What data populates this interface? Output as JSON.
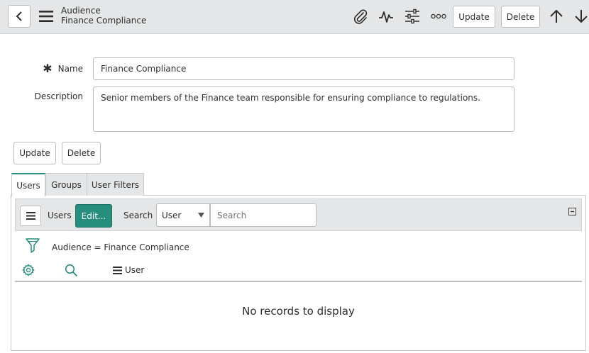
{
  "header": {
    "table_name": "Audience",
    "record_name": "Finance Compliance",
    "update_label": "Update",
    "delete_label": "Delete",
    "icons": [
      "back-icon",
      "menu-icon",
      "attachment-icon",
      "activity-icon",
      "settings-sliders-icon",
      "more-icon",
      "arrow-up-icon",
      "arrow-down-icon"
    ]
  },
  "form": {
    "name_label": "Name",
    "name_required_mark": "✱",
    "name_value": "Finance Compliance",
    "description_label": "Description",
    "description_value": "Senior members of the Finance team responsible for ensuring compliance to regulations.",
    "update_label": "Update",
    "delete_label": "Delete"
  },
  "tabs": [
    {
      "label": "Users",
      "active": true
    },
    {
      "label": "Groups",
      "active": false
    },
    {
      "label": "User Filters",
      "active": false
    }
  ],
  "related_list": {
    "title": "Users",
    "edit_label": "Edit...",
    "search_label": "Search",
    "search_field_selected": "User",
    "search_placeholder": "Search",
    "filter_text": "Audience = Finance Compliance",
    "column_header": "User",
    "empty_message": "No records to display"
  },
  "colors": {
    "accent": "#278d7c",
    "header_bg": "#e4e6e7"
  }
}
